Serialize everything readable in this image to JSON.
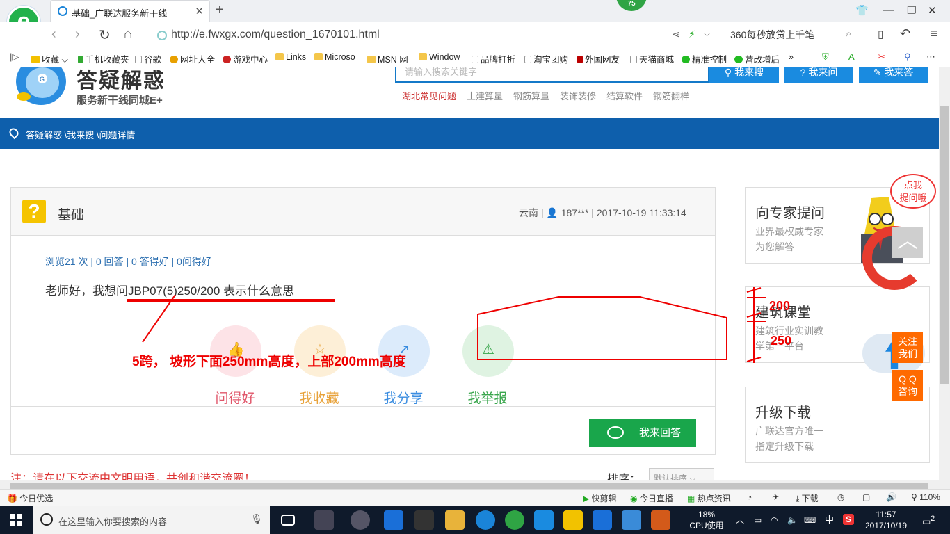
{
  "browser": {
    "tab_title": "基础_广联达服务新干线",
    "new_tab": "+",
    "badge": "75",
    "url": "http://e.fwxgx.com/question_1670101.html",
    "search_text": "360每秒放贷上千笔",
    "bookmarks": [
      "收藏",
      "手机收藏夹",
      "谷歌",
      "网址大全",
      "游戏中心",
      "Links",
      "Microso",
      "MSN 网",
      "Window",
      "品牌打折",
      "淘宝团购",
      "外国网友",
      "天猫商城",
      "精准控制",
      "营改增后"
    ],
    "more": "»"
  },
  "site": {
    "title": "答疑解惑",
    "subtitle": "服务新干线同城E+",
    "search_placeholder": "请输入搜索关键字",
    "buttons": [
      "我来搜",
      "我来问",
      "我来答"
    ],
    "hot_links": [
      "湖北常见问题",
      "土建算量",
      "钢筋算量",
      "装饰装修",
      "结算软件",
      "钢筋翻样"
    ],
    "breadcrumb": "答疑解惑 \\我来搜 \\问题详情"
  },
  "question": {
    "icon": "?",
    "title": "基础",
    "meta": "云南 | 👤 187*** | 2017-10-19 11:33:14",
    "stats": "浏览21 次 | 0 回答 | 0 答得好 | 0问得好",
    "text": "老师好，我想问JBP07(5)250/200 表示什么意思",
    "actions": [
      {
        "label": "问得好",
        "color": "#e0566a",
        "bg": "#fde3e7",
        "glyph": "👍"
      },
      {
        "label": "我收藏",
        "color": "#e8a23a",
        "bg": "#fdefd7",
        "glyph": "☆"
      },
      {
        "label": "我分享",
        "color": "#3b8de0",
        "bg": "#dcebfb",
        "glyph": "↗"
      },
      {
        "label": "我举报",
        "color": "#3aa64d",
        "bg": "#dff3e2",
        "glyph": "⚠"
      }
    ],
    "answer_button": "我来回答",
    "notice": "注：请在以下交流中文明用语，共创和谐交流圈！",
    "sort_label": "排序：",
    "sort_value": "默认排序"
  },
  "sidebar": {
    "cards": [
      {
        "title": "向专家提问",
        "sub": [
          "业界最权威专家",
          "为您解答"
        ]
      },
      {
        "title": "建筑课堂",
        "sub": [
          "建筑行业实训教",
          "学第一平台"
        ]
      },
      {
        "title": "升级下载",
        "sub": [
          "广联达官方唯一",
          "指定升级下载"
        ]
      }
    ],
    "speech": [
      "点我",
      "提问哦"
    ],
    "to_top": "︿",
    "follow": [
      "关注",
      "我们"
    ],
    "qq": [
      "Q Q",
      "咨询"
    ]
  },
  "annotations": {
    "main": "5跨， 坡形下面250mm高度，上部200mm高度",
    "top_height": "200",
    "bottom_height": "250"
  },
  "statusbar": {
    "left": "今日优选",
    "items": [
      "快剪辑",
      "今日直播",
      "热点资讯",
      "下载"
    ],
    "zoom": "110%"
  },
  "taskbar": {
    "search": "在这里输入你要搜索的内容",
    "cpu_pct": "18%",
    "cpu_label": "CPU使用",
    "ime": "中",
    "time": "11:57",
    "date": "2017/10/19",
    "notif": "2"
  }
}
